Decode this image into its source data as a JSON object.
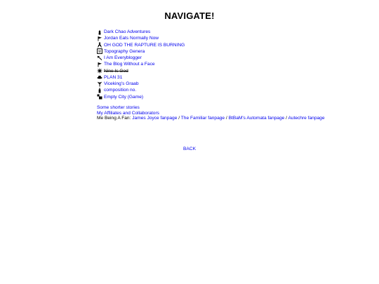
{
  "title": "NAVIGATE!",
  "stories": [
    {
      "label": "Dark Chao Adventures",
      "icon": "chao-icon",
      "style": "link"
    },
    {
      "label": "Jordan Eats Normally Now",
      "icon": "flag-icon",
      "style": "link"
    },
    {
      "label": "OH GOD THE RAPTURE IS BURNING",
      "icon": "figure-icon",
      "style": "link"
    },
    {
      "label": "Topography Genera",
      "icon": "framed-face-icon",
      "style": "link"
    },
    {
      "label": "I Am Everyblogger",
      "icon": "arrow-icon",
      "style": "link"
    },
    {
      "label": "The Blog Without a Face",
      "icon": "flag-icon",
      "style": "link"
    },
    {
      "label": "Nine Is God",
      "icon": "star-burst-icon",
      "style": "strike"
    },
    {
      "label": "PLAN 31",
      "icon": "ufo-icon",
      "style": "link"
    },
    {
      "label": "Viceking's Graab",
      "icon": "fork-icon",
      "style": "link"
    },
    {
      "label": "composition no.",
      "icon": "bottle-icon",
      "style": "link"
    },
    {
      "label": "Empty City (Game)",
      "icon": "blocks-icon",
      "style": "link"
    }
  ],
  "shorter_stories": "Some shorter stories",
  "affiliates": "My Affiliates and Collaborators",
  "fanpages": {
    "prefix": "Me Being A Fan:",
    "separator": " / ",
    "items": [
      "James Joyce fanpage",
      "The Familiar fanpage",
      "BtBaM's Automata fanpage",
      "Autechre fanpage"
    ]
  },
  "back_label": "BACK",
  "colors": {
    "link": "#0000ee",
    "text": "#000000",
    "background": "#ffffff"
  }
}
